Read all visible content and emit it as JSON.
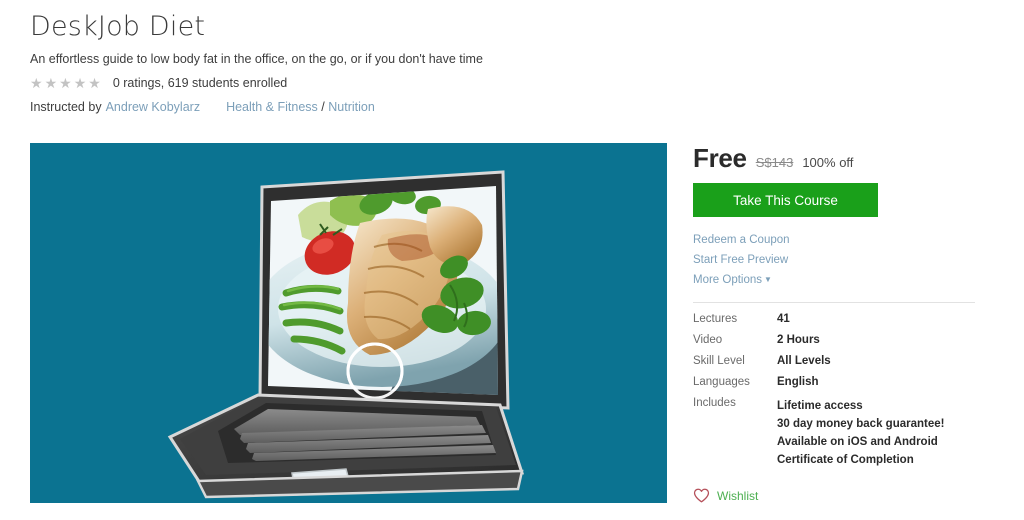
{
  "course": {
    "title": "DeskJob Diet",
    "subtitle": "An effortless guide to low body fat in the office, on the go, or if you don't have time",
    "rating_text": "0 ratings, 619 students enrolled",
    "stars_filled": 0,
    "stars_total": 5,
    "star_glyph": "★",
    "instructed_by_label": "Instructed by",
    "instructor": "Andrew Kobylarz",
    "category": "Health & Fitness",
    "category_separator": "/",
    "subcategory": "Nutrition"
  },
  "image": {
    "alt": "laptop-with-healthy-meal-on-screen",
    "background_color": "#0b7391"
  },
  "panel": {
    "price": "Free",
    "price_original": "S$143",
    "discount": "100% off",
    "cta_label": "Take This Course",
    "links": [
      {
        "name": "redeem-a-coupon",
        "label": "Redeem a Coupon"
      },
      {
        "name": "start-free-preview",
        "label": "Start Free Preview"
      },
      {
        "name": "more-options",
        "label": "More Options",
        "caret": "▼"
      }
    ],
    "details": [
      {
        "key": "Lectures",
        "value": "41"
      },
      {
        "key": "Video",
        "value": "2 Hours"
      },
      {
        "key": "Skill Level",
        "value": "All Levels"
      },
      {
        "key": "Languages",
        "value": "English"
      }
    ],
    "includes_key": "Includes",
    "includes": [
      "Lifetime access",
      "30 day money back guarantee!",
      "Available on iOS and Android",
      "Certificate of Completion"
    ],
    "wishlist_label": "Wishlist"
  },
  "colors": {
    "accent_green": "#1aa01a",
    "link_blue": "#7c9fb9",
    "teal_bg": "#0b7391",
    "wishlist_green": "#4caf50",
    "heart_red": "#b5505a"
  }
}
